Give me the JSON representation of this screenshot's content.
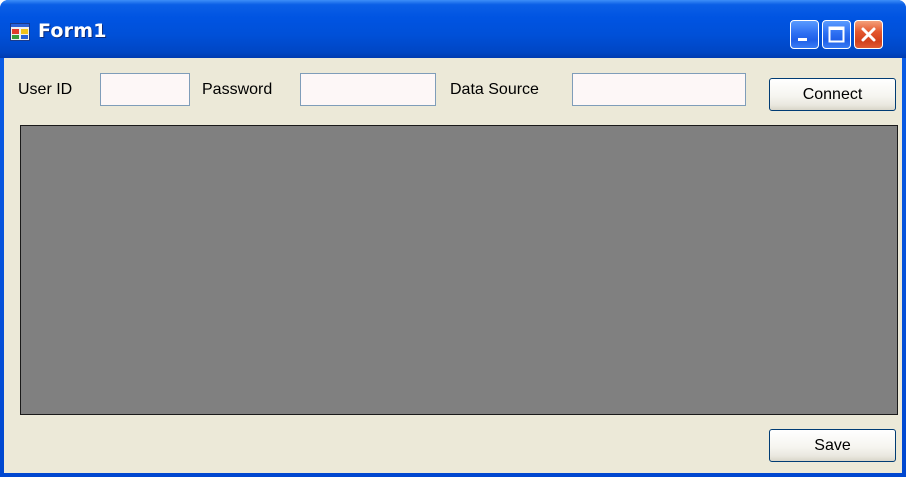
{
  "window": {
    "title": "Form1",
    "icon": "winforms-app-icon",
    "controls": {
      "minimize_icon": "minimize-icon",
      "maximize_icon": "maximize-icon",
      "close_icon": "close-icon"
    }
  },
  "form": {
    "user_id_label": "User ID",
    "user_id_value": "",
    "password_label": "Password",
    "password_value": "",
    "data_source_label": "Data Source",
    "data_source_value": "",
    "connect_label": "Connect",
    "save_label": "Save"
  },
  "colors": {
    "titlebar": "#0054e2",
    "client_background": "#ece9d8",
    "grid_background": "#808080",
    "close_button": "#e4572e"
  }
}
